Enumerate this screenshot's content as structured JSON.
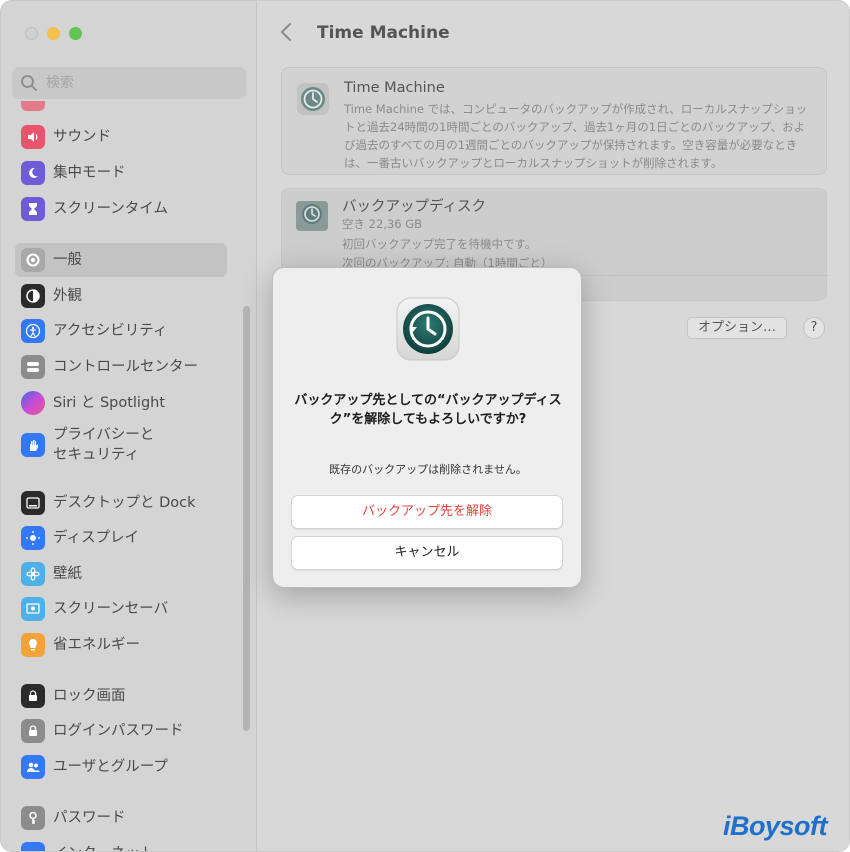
{
  "search": {
    "placeholder": "検索"
  },
  "sidebar": {
    "items": [
      {
        "label": "サウンド",
        "icon": "speaker-icon",
        "color": "#e8546b"
      },
      {
        "label": "集中モード",
        "icon": "moon-icon",
        "color": "#6e5bd6"
      },
      {
        "label": "スクリーンタイム",
        "icon": "hourglass-icon",
        "color": "#6e5bd6"
      },
      {
        "label": "一般",
        "icon": "gear-icon",
        "color": "#a0a0a0"
      },
      {
        "label": "外観",
        "icon": "appearance-icon",
        "color": "#2b2b2b"
      },
      {
        "label": "アクセシビリティ",
        "icon": "accessibility-icon",
        "color": "#3478f6"
      },
      {
        "label": "コントロールセンター",
        "icon": "control-center-icon",
        "color": "#8c8c8c"
      },
      {
        "label": "Siri と Spotlight",
        "icon": "siri-icon",
        "color": "#9a4ad6"
      },
      {
        "label": "プライバシーと",
        "label2": "セキュリティ",
        "icon": "hand-icon",
        "color": "#3478f6"
      },
      {
        "label": "デスクトップと Dock",
        "icon": "dock-icon",
        "color": "#2b2b2b"
      },
      {
        "label": "ディスプレイ",
        "icon": "display-icon",
        "color": "#3478f6"
      },
      {
        "label": "壁紙",
        "icon": "wallpaper-icon",
        "color": "#4fb0e8"
      },
      {
        "label": "スクリーンセーバ",
        "icon": "screensaver-icon",
        "color": "#4fb0e8"
      },
      {
        "label": "省エネルギー",
        "icon": "bulb-icon",
        "color": "#f2a33a"
      },
      {
        "label": "ロック画面",
        "icon": "lock-screen-icon",
        "color": "#2b2b2b"
      },
      {
        "label": "ログインパスワード",
        "icon": "lock-icon",
        "color": "#8c8c8c"
      },
      {
        "label": "ユーザとグループ",
        "icon": "users-icon",
        "color": "#3478f6"
      },
      {
        "label": "パスワード",
        "icon": "key-icon",
        "color": "#8c8c8c"
      },
      {
        "label": "インターネット",
        "icon": "globe-icon",
        "color": "#3478f6"
      }
    ]
  },
  "main": {
    "title": "Time Machine",
    "info_card": {
      "title": "Time Machine",
      "description": "Time Machine では、コンピュータのバックアップが作成され、ローカルスナップショットと過去24時間の1時間ごとのバックアップ、過去1ヶ月の1日ごとのバックアップ、および過去のすべての月の1週間ごとのバックアップが保持されます。空き容量が必要なときは、一番古いバックアップとローカルスナップショットが削除されます。"
    },
    "disk_card": {
      "title": "バックアップディスク",
      "free": "空き 22,36 GB",
      "status": "初回バックアップ完了を待機中です。",
      "next": "次回のバックアップ: 自動（1時間ごと）"
    },
    "options_label": "オプション…",
    "help_label": "?"
  },
  "dialog": {
    "title": "バックアップ先としての“バックアップディスク”を解除してもよろしいですか?",
    "message": "既存のバックアップは削除されません。",
    "remove_label": "バックアップ先を解除",
    "cancel_label": "キャンセル",
    "remove_color": "#e8413a"
  },
  "watermark": "iBoysoft"
}
